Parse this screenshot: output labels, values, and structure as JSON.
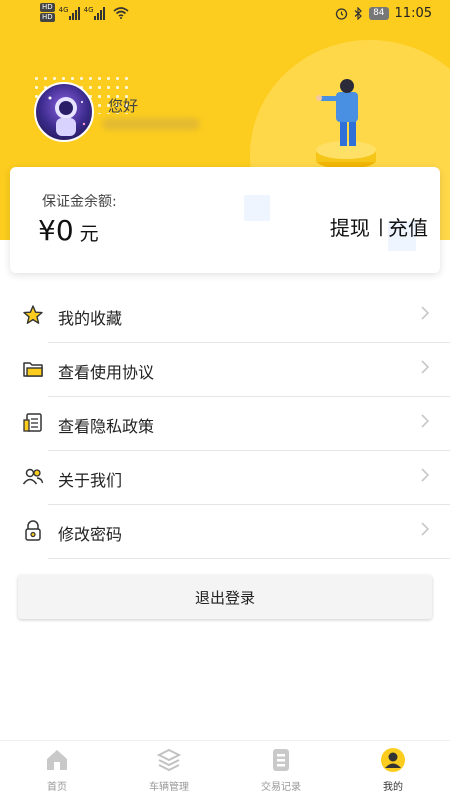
{
  "status_bar": {
    "hd1": "HD",
    "hd2": "HD",
    "net1": "4G",
    "net2": "4G",
    "battery": "84",
    "time": "11:05"
  },
  "profile": {
    "greeting": "您好"
  },
  "balance": {
    "label": "保证金余额:",
    "currency": "¥",
    "amount": "0",
    "unit": "元",
    "withdraw_label": "提现",
    "separator": "|",
    "recharge_label": "充值"
  },
  "menu": [
    {
      "label": "我的收藏",
      "icon": "star-icon"
    },
    {
      "label": "查看使用协议",
      "icon": "folder-icon"
    },
    {
      "label": "查看隐私政策",
      "icon": "document-icon"
    },
    {
      "label": "关于我们",
      "icon": "users-icon"
    },
    {
      "label": "修改密码",
      "icon": "lock-icon"
    }
  ],
  "logout_label": "退出登录",
  "tabs": [
    {
      "label": "首页",
      "icon": "home-icon",
      "active": false
    },
    {
      "label": "车辆管理",
      "icon": "layers-icon",
      "active": false
    },
    {
      "label": "交易记录",
      "icon": "list-icon",
      "active": false
    },
    {
      "label": "我的",
      "icon": "profile-icon",
      "active": true
    }
  ],
  "colors": {
    "accent": "#FCCD1E",
    "accent_light": "#FFD84A",
    "text": "#222222",
    "tab_inactive": "#999999"
  }
}
